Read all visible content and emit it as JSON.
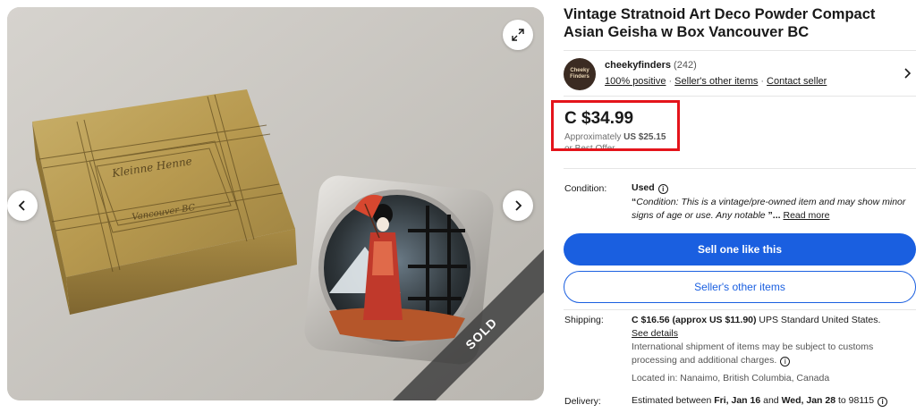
{
  "listing": {
    "title": "Vintage Stratnoid Art Deco Powder Compact Asian Geisha w Box Vancouver BC",
    "sold_label": "SOLD",
    "box_engraving": [
      "Kleinne Henne",
      "Vancouver BC"
    ]
  },
  "seller": {
    "avatar_text": "Cheeky Finders",
    "name": "cheekyfinders",
    "count": "(242)",
    "positive": "100% positive",
    "other_items": "Seller's other items",
    "contact": "Contact seller"
  },
  "price": {
    "amount": "C $34.99",
    "approx_prefix": "Approximately",
    "approx_value": "US $25.15",
    "best_offer": "or Best Offer"
  },
  "condition": {
    "label": "Condition:",
    "value": "Used",
    "quote_open": "“",
    "description": "Condition: This is a vintage/pre-owned item and may show minor signs of age or use. Any notable",
    "quote_close": "”...",
    "read_more": "Read more"
  },
  "actions": {
    "sell_one": "Sell one like this",
    "other_items": "Seller's other items"
  },
  "shipping": {
    "label": "Shipping:",
    "cost": "C $16.56 (approx US $11.90)",
    "service": "UPS Standard United States.",
    "see_details": "See details",
    "international": "International shipment of items may be subject to customs processing and additional charges.",
    "location": "Located in: Nanaimo, British Columbia, Canada"
  },
  "delivery": {
    "label": "Delivery:",
    "prefix": "Estimated between",
    "start": "Fri, Jan 16",
    "and": "and",
    "end": "Wed, Jan 28",
    "to": "to 98115"
  },
  "icons": {
    "expand": "expand-icon",
    "prev": "chevron-left-icon",
    "next": "chevron-right-icon",
    "seller_chevron": "chevron-right-icon",
    "info": "info-icon"
  },
  "colors": {
    "primary": "#1a5fe0",
    "highlight_box": "#e4141b",
    "text": "#191919",
    "muted": "#707070"
  }
}
